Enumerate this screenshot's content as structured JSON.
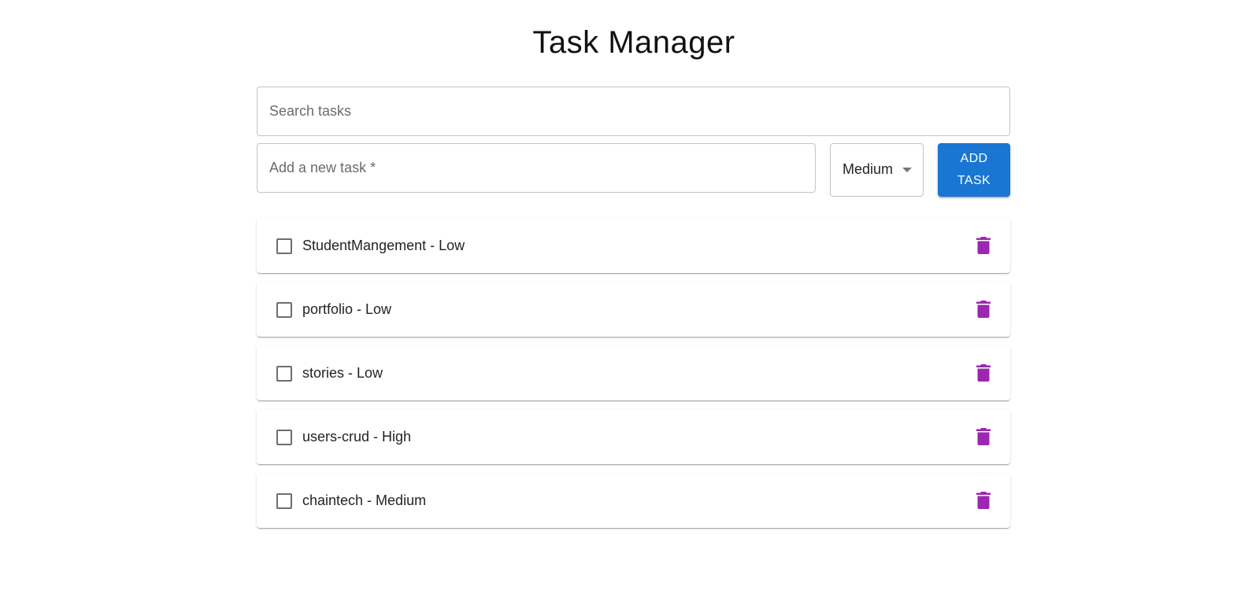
{
  "page": {
    "title": "Task Manager"
  },
  "search": {
    "placeholder": "Search tasks",
    "value": ""
  },
  "new_task": {
    "placeholder": "Add a new task *",
    "value": ""
  },
  "priority_select": {
    "selected": "Medium",
    "icon": "chevron-down-icon"
  },
  "add_button": {
    "label": "ADD TASK",
    "color": "#1976d2"
  },
  "tasks": [
    {
      "label": "StudentMangement - Low",
      "checked": false
    },
    {
      "label": "portfolio - Low",
      "checked": false
    },
    {
      "label": "stories - Low",
      "checked": false
    },
    {
      "label": "users-crud - High",
      "checked": false
    },
    {
      "label": "chaintech - Medium",
      "checked": false
    }
  ],
  "colors": {
    "delete_icon": "#9c27b0",
    "checkbox_border": "#6e6e6e",
    "field_border": "#c4c4c4"
  },
  "icons": {
    "delete": "trash-icon",
    "checkbox": "checkbox-unchecked-icon"
  }
}
